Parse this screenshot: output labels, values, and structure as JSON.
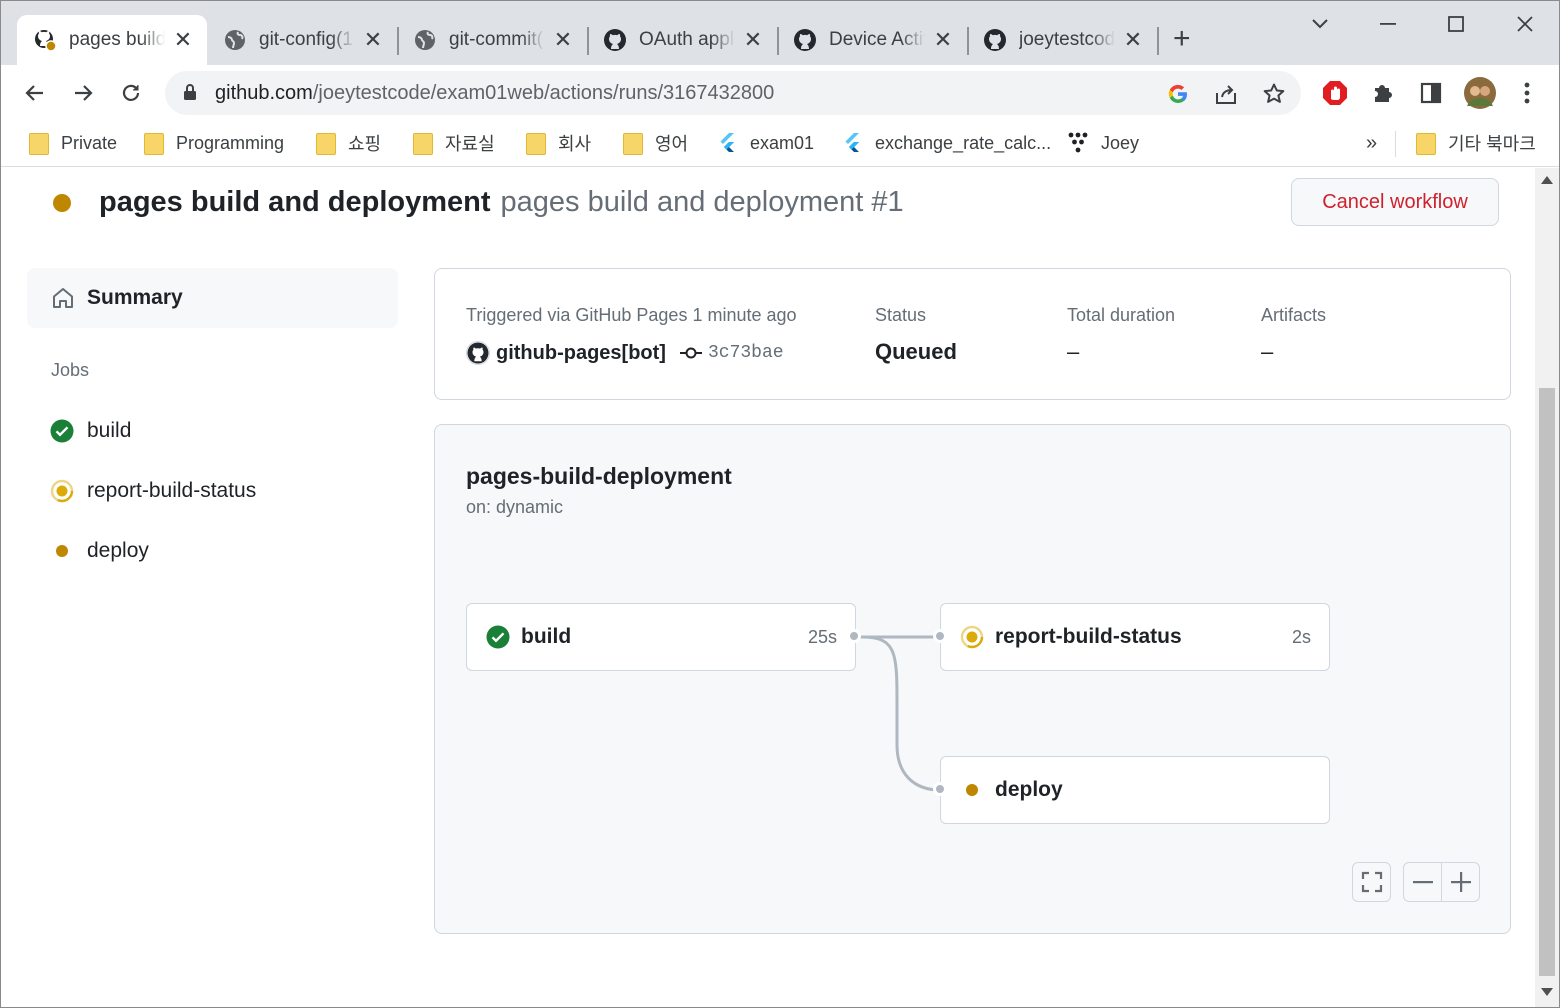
{
  "browser": {
    "tabs": [
      {
        "title": "pages build and deployment",
        "icon": "github-actions-icon"
      },
      {
        "title": "git-config(1)",
        "icon": "globe-icon"
      },
      {
        "title": "git-commit(1)",
        "icon": "globe-icon"
      },
      {
        "title": "OAuth applications",
        "icon": "github-icon"
      },
      {
        "title": "Device Activation",
        "icon": "github-icon"
      },
      {
        "title": "joeytestcode",
        "icon": "github-icon"
      }
    ],
    "url_host": "github.com",
    "url_path": "/joeytestcode/exam01web/actions/runs/3167432800",
    "bookmarks": [
      {
        "label": "Private",
        "icon": "folder-icon"
      },
      {
        "label": "Programming",
        "icon": "folder-icon"
      },
      {
        "label": "쇼핑",
        "icon": "folder-icon"
      },
      {
        "label": "자료실",
        "icon": "folder-icon"
      },
      {
        "label": "회사",
        "icon": "folder-icon"
      },
      {
        "label": "영어",
        "icon": "folder-icon"
      },
      {
        "label": "exam01",
        "icon": "flutter-icon"
      },
      {
        "label": "exchange_rate_calc...",
        "icon": "flutter-icon"
      },
      {
        "label": "Joey",
        "icon": "tree-icon"
      }
    ],
    "bookmarks_overflow": "»",
    "other_bookmarks": "기타 북마크"
  },
  "run": {
    "title": "pages build and deployment",
    "subtitle": "pages build and deployment #1",
    "cancel_label": "Cancel workflow",
    "status_color": "#bf8700"
  },
  "sidebar": {
    "summary_label": "Summary",
    "jobs_heading": "Jobs",
    "jobs": [
      {
        "name": "build",
        "state": "success"
      },
      {
        "name": "report-build-status",
        "state": "in-progress"
      },
      {
        "name": "deploy",
        "state": "queued"
      }
    ]
  },
  "summary": {
    "trigger_text": "Triggered via GitHub Pages 1 minute ago",
    "actor": "github-pages[bot]",
    "commit": "3c73bae",
    "status_label": "Status",
    "status_value": "Queued",
    "duration_label": "Total duration",
    "duration_value": "–",
    "artifacts_label": "Artifacts",
    "artifacts_value": "–"
  },
  "graph": {
    "workflow_name": "pages-build-deployment",
    "trigger": "on: dynamic",
    "nodes": [
      {
        "name": "build",
        "duration": "25s",
        "state": "success"
      },
      {
        "name": "report-build-status",
        "duration": "2s",
        "state": "in-progress"
      },
      {
        "name": "deploy",
        "duration": "",
        "state": "queued"
      }
    ]
  },
  "colors": {
    "success": "#1a7f37",
    "in_progress": "#dbab0a",
    "queued": "#bf8700",
    "danger": "#cf222e"
  }
}
